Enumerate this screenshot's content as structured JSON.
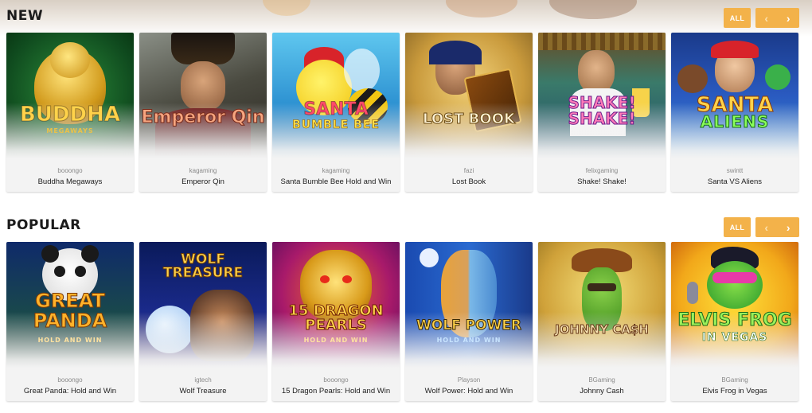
{
  "sections": {
    "new": {
      "title": "NEW",
      "all_label": "ALL",
      "games": [
        {
          "provider": "booongo",
          "name": "Buddha Megaways",
          "art": "BUDDHA",
          "art_sub": "MEGAWAYS"
        },
        {
          "provider": "kagaming",
          "name": "Emperor Qin",
          "art": "Emperor Qin",
          "art_sub": ""
        },
        {
          "provider": "kagaming",
          "name": "Santa Bumble Bee Hold and Win",
          "art": "SANTA",
          "art_sub": "BUMBLE BEE"
        },
        {
          "provider": "fazi",
          "name": "Lost Book",
          "art": "LOST BOOK",
          "art_sub": ""
        },
        {
          "provider": "felixgaming",
          "name": "Shake! Shake!",
          "art": "SHAKE! SHAKE!",
          "art_sub": ""
        },
        {
          "provider": "swintt",
          "name": "Santa VS Aliens",
          "art": "SANTA",
          "art_sub": "ALIENS"
        }
      ]
    },
    "popular": {
      "title": "POPULAR",
      "all_label": "ALL",
      "games": [
        {
          "provider": "booongo",
          "name": "Great Panda: Hold and Win",
          "art": "GREAT PANDA",
          "art_sub": "HOLD AND WIN"
        },
        {
          "provider": "igtech",
          "name": "Wolf Treasure",
          "art": "WOLF TREASURE",
          "art_sub": ""
        },
        {
          "provider": "booongo",
          "name": "15 Dragon Pearls: Hold and Win",
          "art": "15 DRAGON PEARLS",
          "art_sub": "HOLD AND WIN"
        },
        {
          "provider": "Playson",
          "name": "Wolf Power: Hold and Win",
          "art": "WOLF POWER",
          "art_sub": "HOLD AND WIN"
        },
        {
          "provider": "BGaming",
          "name": "Johnny Cash",
          "art": "JOHNNY CA$H",
          "art_sub": ""
        },
        {
          "provider": "BGaming",
          "name": "Elvis Frog in Vegas",
          "art": "ELVIS FROG",
          "art_sub": "IN VEGAS"
        }
      ]
    }
  },
  "controls": {
    "prev_icon": "chevron-left-icon",
    "next_icon": "chevron-right-icon",
    "prev_glyph": "‹",
    "next_glyph": "›"
  },
  "colors": {
    "accent": "#f3b24a",
    "card_bg": "#f3f3f3",
    "provider_text": "#8a8a8a"
  }
}
